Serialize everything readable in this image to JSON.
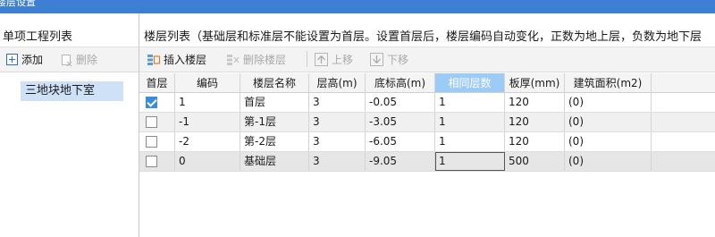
{
  "window": {
    "title": "楼层设置"
  },
  "left_panel": {
    "title": "单项工程列表",
    "add_label": "添加",
    "delete_label": "删除",
    "items": [
      "三地块地下室"
    ]
  },
  "right_panel": {
    "title": "楼层列表（基础层和标准层不能设置为首层。设置首层后，楼层编码自动变化，正数为地上层，负数为地下层",
    "toolbar": {
      "insert_label": "插入楼层",
      "delete_label": "删除楼层",
      "up_label": "上移",
      "down_label": "下移"
    },
    "columns": [
      "首层",
      "编码",
      "楼层名称",
      "层高(m)",
      "底标高(m)",
      "相同层数",
      "板厚(mm)",
      "建筑面积(m2)"
    ],
    "rows": [
      {
        "first": true,
        "code": "1",
        "name": "首层",
        "height": "3",
        "bottom": "-0.05",
        "same": "1",
        "thick": "120",
        "area": "(0)"
      },
      {
        "first": false,
        "code": "-1",
        "name": "第-1层",
        "height": "3",
        "bottom": "-3.05",
        "same": "1",
        "thick": "120",
        "area": "(0)"
      },
      {
        "first": false,
        "code": "-2",
        "name": "第-2层",
        "height": "3",
        "bottom": "-6.05",
        "same": "1",
        "thick": "120",
        "area": "(0)"
      },
      {
        "first": false,
        "code": "0",
        "name": "基础层",
        "height": "3",
        "bottom": "-9.05",
        "same": "1",
        "thick": "500",
        "area": "(0)"
      }
    ]
  }
}
